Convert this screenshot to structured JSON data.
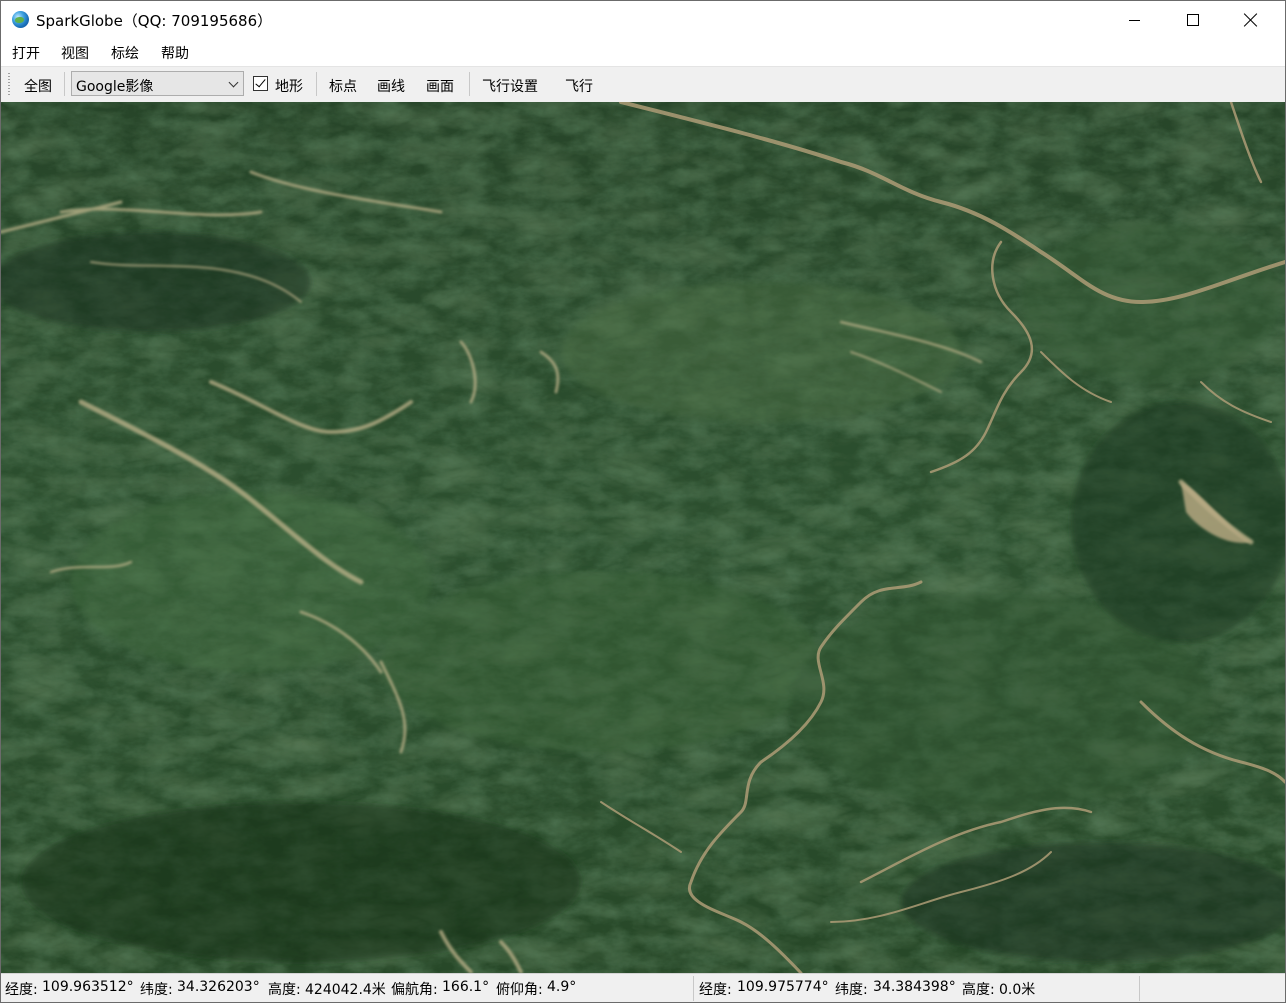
{
  "window": {
    "title": "SparkGlobe（QQ: 709195686）",
    "icon": "globe-icon"
  },
  "menu": {
    "items": [
      "打开",
      "视图",
      "标绘",
      "帮助"
    ]
  },
  "toolbar": {
    "full_view_label": "全图",
    "layer_select_value": "Google影像",
    "terrain_checkbox": {
      "label": "地形",
      "checked": true
    },
    "placemark_label": "标点",
    "draw_line_label": "画线",
    "draw_polygon_label": "画面",
    "flight_settings_label": "飞行设置",
    "fly_label": "飞行"
  },
  "map": {
    "description_type": "3D terrain satellite imagery",
    "colors": {
      "forest_dark": "#1f3a22",
      "forest_mid": "#2f5532",
      "forest_light": "#4a7a45",
      "ridge_highlight": "#c9b98a",
      "road": "#b8a67e"
    }
  },
  "status": {
    "camera": {
      "longitude_label": "经度:",
      "longitude": "109.963512°",
      "latitude_label": "纬度:",
      "latitude": "34.326203°",
      "altitude_label": "高度:",
      "altitude": "424042.4米",
      "heading_label": "偏航角:",
      "heading": "166.1°",
      "pitch_label": "俯仰角:",
      "pitch": "4.9°"
    },
    "cursor": {
      "longitude_label": "经度:",
      "longitude": "109.975774°",
      "latitude_label": "纬度:",
      "latitude": "34.384398°",
      "altitude_label": "高度:",
      "altitude": "0.0米"
    }
  }
}
